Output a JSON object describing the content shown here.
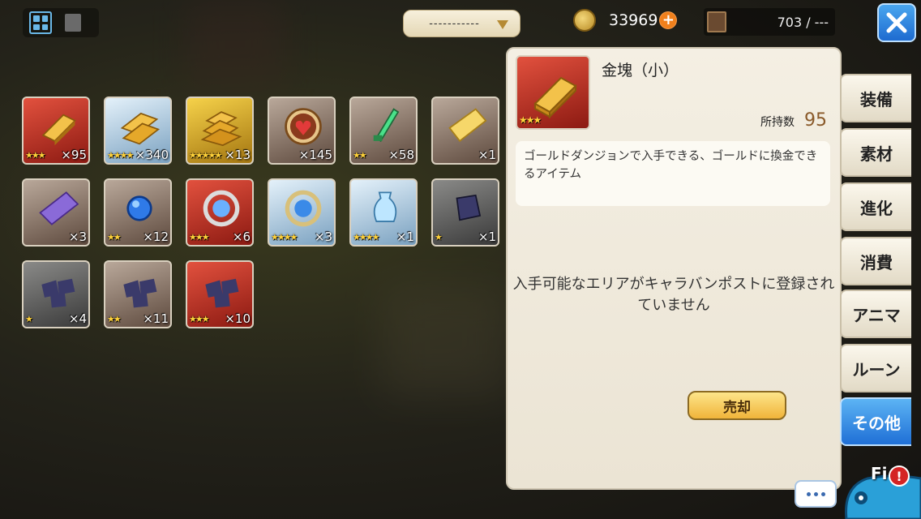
{
  "toolbar": {
    "view_grid_icon": "grid-icon",
    "view_list_icon": "list-icon",
    "sort_dropdown_value": "-----------",
    "gold_amount": "33969",
    "inventory_capacity": "703 / ---"
  },
  "items": [
    {
      "name": "gold-bar-small",
      "rarity": 3,
      "stars": "★★★",
      "count": "×95"
    },
    {
      "name": "gold-bars-medium",
      "rarity": 4,
      "stars": "★★★★",
      "count": "×340"
    },
    {
      "name": "gold-bars-large",
      "rarity": 5,
      "stars": "★★★★★",
      "count": "×13"
    },
    {
      "name": "heart-medal",
      "rarity": 2,
      "stars": "",
      "count": "×145"
    },
    {
      "name": "green-dagger",
      "rarity": 2,
      "stars": "★★",
      "count": "×58"
    },
    {
      "name": "gold-ticket",
      "rarity": 2,
      "stars": "",
      "count": "×1"
    },
    {
      "name": "purple-ticket",
      "rarity": 2,
      "stars": "",
      "count": "×3"
    },
    {
      "name": "blue-orb",
      "rarity": 2,
      "stars": "★★",
      "count": "×12"
    },
    {
      "name": "ring-emblem-red",
      "rarity": 3,
      "stars": "★★★",
      "count": "×6"
    },
    {
      "name": "ring-emblem-blue",
      "rarity": 4,
      "stars": "★★★★",
      "count": "×3"
    },
    {
      "name": "crystal-vase",
      "rarity": 4,
      "stars": "★★★★",
      "count": "×1"
    },
    {
      "name": "rune-stone",
      "rarity": 1,
      "stars": "★",
      "count": "×1"
    },
    {
      "name": "rune-stones-small",
      "rarity": 1,
      "stars": "★",
      "count": "×4"
    },
    {
      "name": "rune-stones-medium",
      "rarity": 2,
      "stars": "★★",
      "count": "×11"
    },
    {
      "name": "rune-stones-red",
      "rarity": 3,
      "stars": "★★★",
      "count": "×10"
    }
  ],
  "detail": {
    "title": "金塊（小）",
    "stars": "★★★",
    "owned_label": "所持数",
    "owned_count": "95",
    "description": "ゴールドダンジョンで入手できる、ゴールドに換金できるアイテム",
    "area_message": "入手可能なエリアがキャラバンポストに登録されていません",
    "sell_label": "売却"
  },
  "tabs": [
    {
      "label": "装備",
      "active": false
    },
    {
      "label": "素材",
      "active": false
    },
    {
      "label": "進化",
      "active": false
    },
    {
      "label": "消費",
      "active": false
    },
    {
      "label": "アニマ",
      "active": false
    },
    {
      "label": "ルーン",
      "active": false
    },
    {
      "label": "その他",
      "active": true
    }
  ],
  "bottom": {
    "field_label": "Fi d",
    "alert_mark": "!"
  },
  "colors": {
    "accent_blue": "#1f6fd6",
    "gold_text": "#8a5a2a",
    "sell_button": "#f0b43a"
  }
}
